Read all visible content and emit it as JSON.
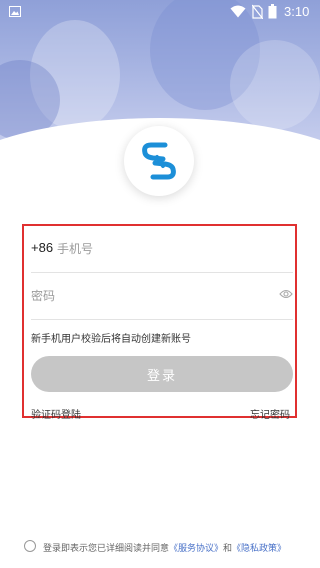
{
  "statusbar": {
    "time": "3:10",
    "icons": [
      "image-notification-icon",
      "wifi-icon",
      "no-sim-icon",
      "battery-icon"
    ]
  },
  "logo": {
    "icon": "brand-logo-icon",
    "color": "#1c8fd8"
  },
  "form": {
    "country_code": "+86",
    "phone_placeholder": "手机号",
    "password_placeholder": "密码",
    "password_toggle_icon": "eye-icon",
    "hint": "新手机用户校验后将自动创建新账号",
    "login_label": "登录",
    "sms_login_link": "验证码登陆",
    "forgot_password_link": "忘记密码"
  },
  "agreement": {
    "prefix": "登录即表示您已详细阅读并同意",
    "service_link": "《服务协议》",
    "conjunction": "和",
    "privacy_link": "《隐私政策》"
  },
  "colors": {
    "highlight_border": "#e03030",
    "button_disabled": "#c6c6c6",
    "link": "#4a72c8"
  }
}
